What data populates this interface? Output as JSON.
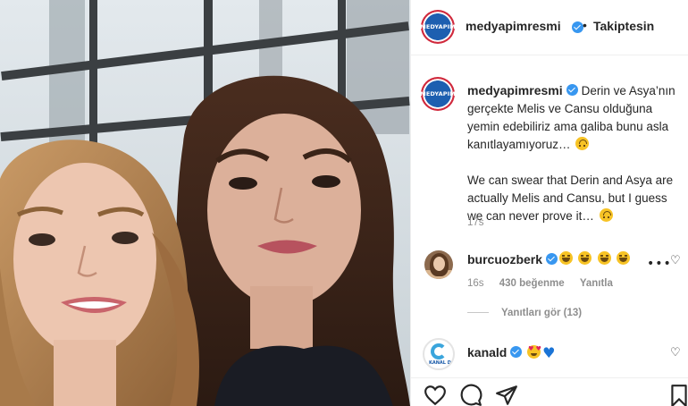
{
  "post": {
    "username": "medyapimresmi",
    "follow_status": "Takiptesin",
    "dot": "•",
    "brand_avatar_text": "MEDYAPIM",
    "caption_tr": "Derin ve Asya’nın gerçekte Melis ve Cansu olduğuna yemin edebiliriz ama galiba bunu asla kanıtlayamıyoruz…",
    "caption_en": "We can swear that Derin and Asya are actually Melis and Cansu, but I guess we can never prove it…",
    "caption_time": "17s",
    "image_colors": {
      "window_sky": "#dfe6ea",
      "frame": "#3b3f42",
      "hair_blonde": "#b98b5a",
      "hair_dark": "#3a2418",
      "top_dark": "#1a1c24"
    }
  },
  "comments": [
    {
      "username": "burcuozberk",
      "text_emojis": [
        "laugh",
        "laugh",
        "laugh",
        "laugh"
      ],
      "time": "16s",
      "likes": "430 beğenme",
      "reply_label": "Yanıtla",
      "replies_label": "Yanıtları gör (13)"
    },
    {
      "username": "kanald",
      "text_emojis": [
        "heart-eyes",
        "blue-heart"
      ],
      "avatar_text": "KANAL D"
    }
  ],
  "icons": {
    "like": "heart-outline-icon",
    "comment": "comment-bubble-icon",
    "share": "paper-plane-icon",
    "save": "bookmark-icon",
    "more": "more-horizontal-icon",
    "verified": "verified-badge-icon"
  },
  "colors": {
    "verified": "#3897f0",
    "muted_text": "#8e8e8e",
    "text": "#262626",
    "divider": "#efefef"
  }
}
